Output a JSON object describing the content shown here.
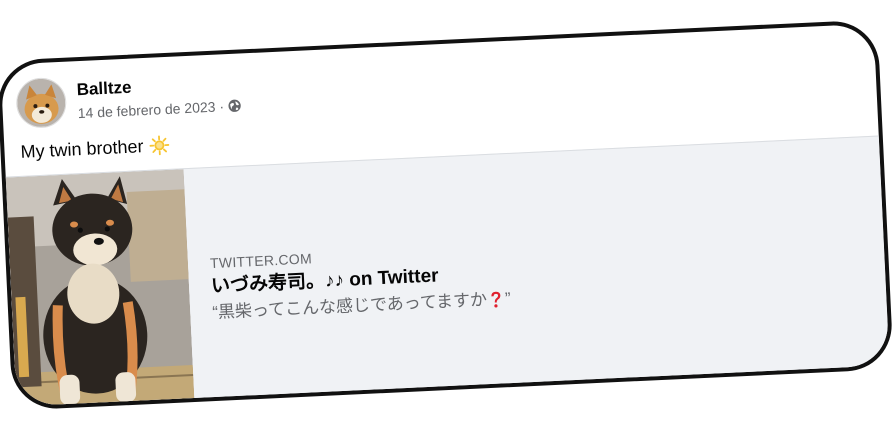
{
  "post": {
    "author": "Balltze",
    "date": "14 de febrero de 2023",
    "separator": "·",
    "audience_icon": "globe-icon",
    "text": "My twin brother",
    "text_emoji_icon": "sun-emoji-icon"
  },
  "link_preview": {
    "domain": "TWITTER.COM",
    "title": "いづみ寿司。♪♪ on Twitter",
    "description_open_quote": "“",
    "description_text": "黒柴ってこんな感じであってますか",
    "description_emoji_icon": "red-question-mark-icon",
    "description_close_quote": "”",
    "thumbnail_subject": "black shiba inu dog sitting"
  },
  "colors": {
    "card_border": "#111111",
    "preview_background": "#f0f2f5",
    "secondary_text": "#65676b",
    "primary_text": "#050505",
    "emoji_red": "#e0202e",
    "sun_yellow": "#f7c531"
  }
}
